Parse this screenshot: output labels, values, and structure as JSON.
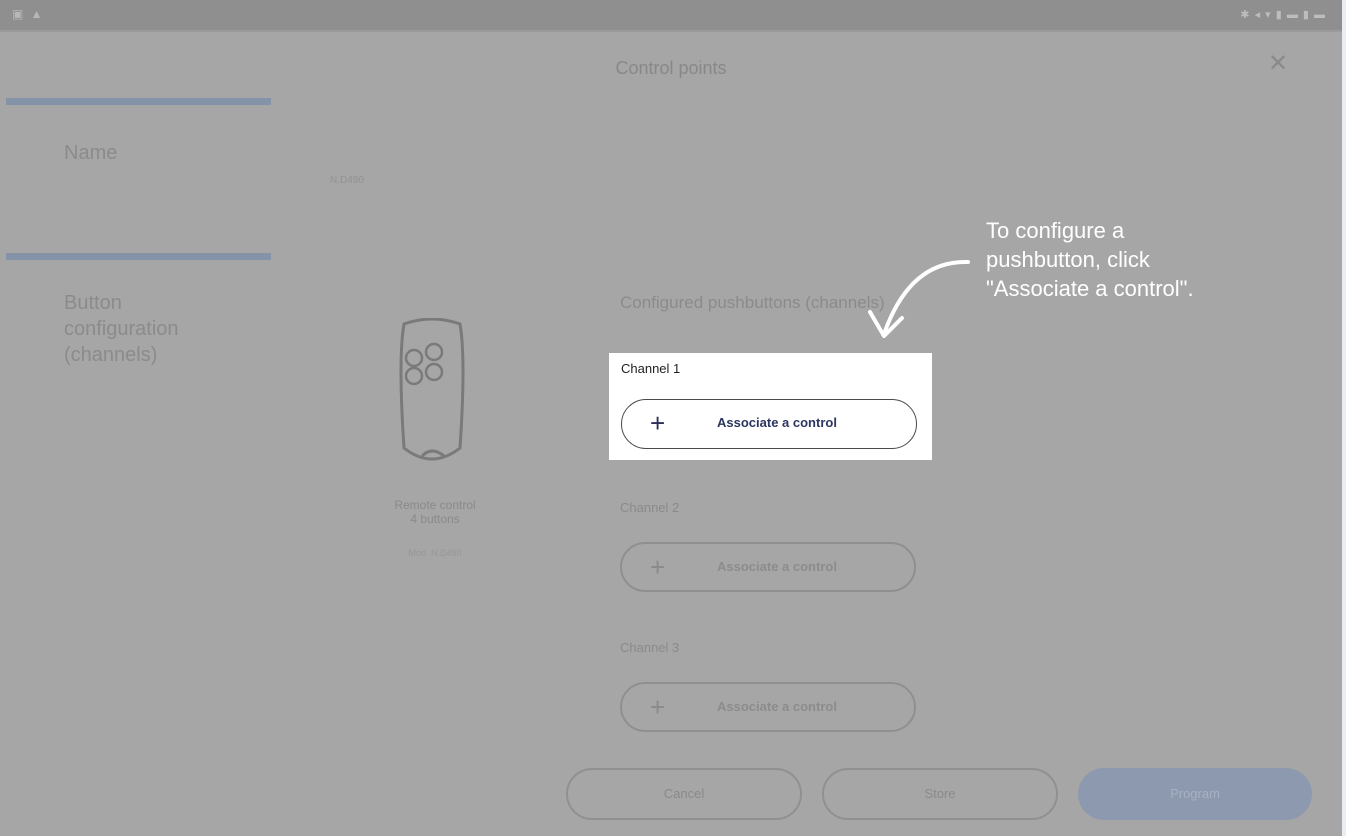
{
  "dialog": {
    "title": "Control points",
    "close_icon": "close-icon"
  },
  "sections": {
    "name_label": "Name",
    "name_value": "N.D490",
    "button_config_label_line1": "Button",
    "button_config_label_line2": "configuration",
    "button_config_label_line3": "(channels)"
  },
  "remote": {
    "icon": "remote-control-icon",
    "caption_line1": "Remote control",
    "caption_line2": "4 buttons",
    "model": "Mod. N.D490"
  },
  "channels": {
    "heading": "Configured pushbuttons (channels)",
    "items": [
      {
        "label": "Channel 1",
        "button": "Associate a control"
      },
      {
        "label": "Channel 2",
        "button": "Associate a control"
      },
      {
        "label": "Channel 3",
        "button": "Associate a control"
      }
    ]
  },
  "footer": {
    "cancel": "Cancel",
    "store": "Store",
    "program": "Program"
  },
  "callout": {
    "line1": "To configure a",
    "line2": "pushbutton, click",
    "line3": "\"Associate a control\"."
  },
  "colors": {
    "overlay": "#a6a6a6",
    "accent": "#2c3660",
    "program_button": "#8d99ae"
  }
}
